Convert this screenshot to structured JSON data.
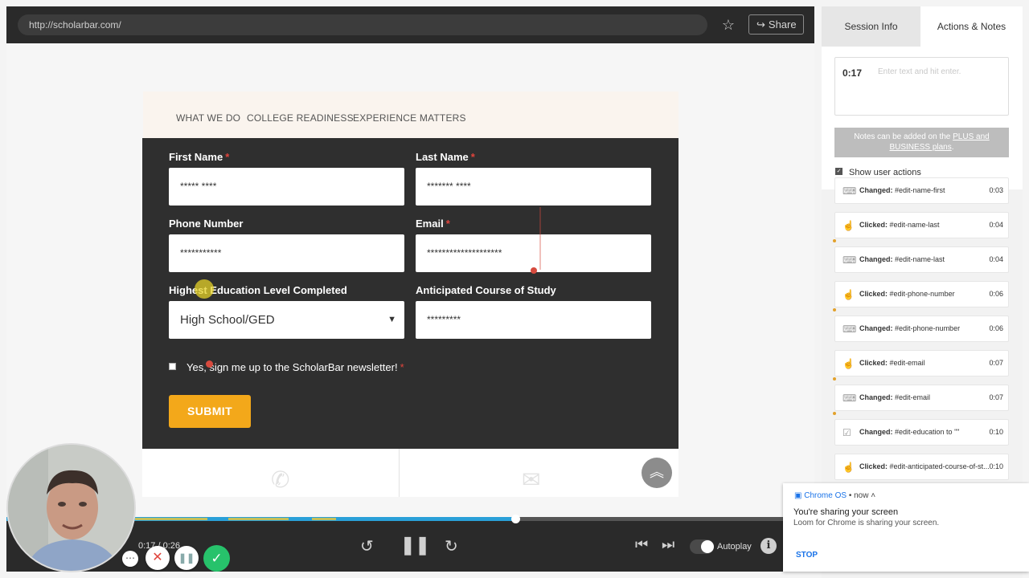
{
  "browser": {
    "url": "http://scholarbar.com/",
    "share_label": "Share",
    "star_icon": "star-icon"
  },
  "site": {
    "nav": [
      "WHAT WE DO",
      "COLLEGE READINESS",
      "EXPERIENCE MATTERS"
    ],
    "form": {
      "first_name_label": "First Name",
      "last_name_label": "Last Name",
      "phone_label": "Phone Number",
      "email_label": "Email",
      "education_label": "Highest Education Level Completed",
      "course_label": "Anticipated Course of Study",
      "required_mark": "*",
      "first_name_value": "***** ****",
      "last_name_value": "******* ****",
      "phone_value": "***********",
      "email_value": "********************",
      "education_value": "High School/GED",
      "course_value": "*********",
      "newsletter_label": "Yes, sign me up to the ScholarBar newsletter!",
      "submit_label": "SUBMIT"
    }
  },
  "player": {
    "time": "0:17 / 0:26",
    "autoplay_label": "Autoplay",
    "progress": 0.63
  },
  "side_panel": {
    "tabs": [
      "Session Info",
      "Actions & Notes"
    ],
    "notes_time": "0:17",
    "notes_placeholder": "Enter text and hit enter.",
    "plus_note_pre": "Notes can be added on the ",
    "plus_note_link": "PLUS and BUSINESS plans",
    "plus_note_post": ".",
    "show_actions_label": "Show user actions",
    "actions": [
      {
        "verb": "Changed:",
        "target": "#edit-name-first",
        "time": "0:03",
        "icon": "keyboard-icon"
      },
      {
        "verb": "Clicked:",
        "target": "#edit-name-last",
        "time": "0:04",
        "icon": "click-icon"
      },
      {
        "verb": "Changed:",
        "target": "#edit-name-last",
        "time": "0:04",
        "icon": "keyboard-icon"
      },
      {
        "verb": "Clicked:",
        "target": "#edit-phone-number",
        "time": "0:06",
        "icon": "click-icon"
      },
      {
        "verb": "Changed:",
        "target": "#edit-phone-number",
        "time": "0:06",
        "icon": "keyboard-icon"
      },
      {
        "verb": "Clicked:",
        "target": "#edit-email",
        "time": "0:07",
        "icon": "click-icon"
      },
      {
        "verb": "Changed:",
        "target": "#edit-email",
        "time": "0:07",
        "icon": "keyboard-icon"
      },
      {
        "verb": "Changed:",
        "target": "#edit-education to \"\"",
        "time": "0:10",
        "icon": "checkbox-icon"
      },
      {
        "verb": "Clicked:",
        "target": "#edit-anticipated-course-of-st...",
        "time": "0:10",
        "icon": "click-icon"
      }
    ]
  },
  "notification": {
    "source": "Chrome OS",
    "when": "• now",
    "title": "You're sharing your screen",
    "body": "Loom for Chrome is sharing your screen.",
    "stop_label": "STOP"
  },
  "colors": {
    "accent_orange": "#f3a81a",
    "progress_blue": "#2aa0d8",
    "required_red": "#e0443c",
    "loom_green": "#27c26b"
  }
}
